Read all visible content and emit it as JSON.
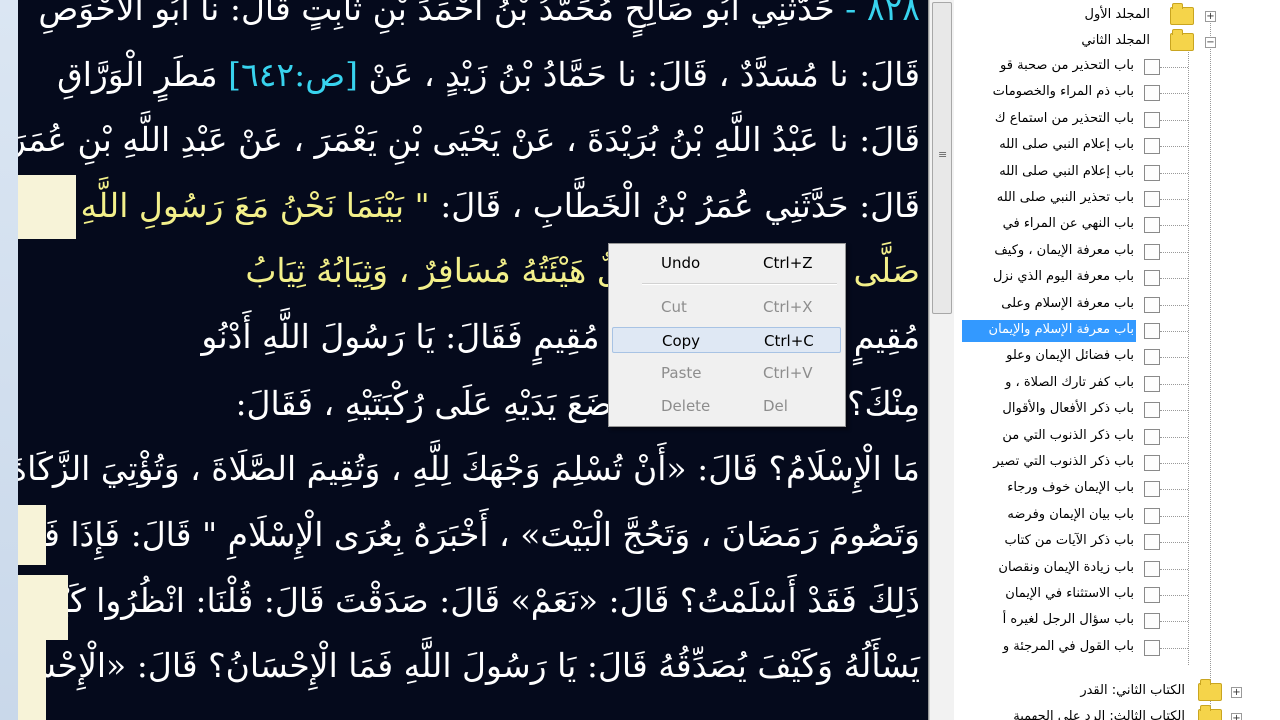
{
  "reader": {
    "lines": [
      {
        "text": "حَدَّثَنِي أَبُو صَالِحٍ مُحَمَّدُ بْنُ أَحْمَدَ بْنِ ثَابِتٍ قَالَ: نا أَبُو الْأَحْوَصِ",
        "number": "٨٢٨ -",
        "color": "white"
      },
      {
        "text": "قَالَ: نا مُسَدَّدٌ ، قَالَ: نا حَمَّادُ بْنُ زَيْدٍ ، عَنْ",
        "page_ref": "[ص:٦٤٢]",
        "text2": "مَطَرٍ الْوَرَّاقِ",
        "color": "white"
      },
      {
        "text": "قَالَ: نا عَبْدُ اللَّهِ بْنُ بُرَيْدَةَ ، عَنْ يَحْيَى بْنِ يَعْمَرَ ، عَنْ عَبْدِ اللَّهِ بْنِ عُمَرَ",
        "color": "white"
      },
      {
        "text": "قَالَ: حَدَّثَنِي عُمَرُ بْنُ الْخَطَّابِ ، قَالَ:",
        "hadith": "\" بَيْنَمَا نَحْنُ مَعَ رَسُولِ اللَّهِ",
        "color": "white"
      },
      {
        "text": "صَلَّى ا",
        "hadith": "يَوْمٍ إِذْ جَاءَهُ رَجُلٌ هَيْئَتُهُ مُسَافِرٌ ، وَثِيَابُهُ ثِيَابُ",
        "color": "yellow"
      },
      {
        "text": "مُقِيمٍ ،",
        "text2": "فِرٍ ، وَهَيْئَتُهُ هَيْئَةُ مُقِيمٍ فَقَالَ: يَا رَسُولَ اللَّهِ أَدْنُو",
        "color": "white"
      },
      {
        "text": "مِنْكَ؟",
        "text2": "فَدَنَا مِنْهُ ، حَتَّى وَضَعَ يَدَيْهِ عَلَى رُكْبَتَيْهِ ، فَقَالَ:",
        "color": "white"
      },
      {
        "text": "مَا الْإِسْلَامُ؟ قَالَ: «أَنْ تُسْلِمَ وَجْهَكَ لِلَّهِ ، وَتُقِيمَ الصَّلَاةَ ، وَتُؤْتِيَ الزَّكَاةَ ،",
        "color": "white"
      },
      {
        "text": "وَتَصُومَ رَمَضَانَ ، وَتَحُجَّ الْبَيْتَ» ، أَخْبَرَهُ بِعُرَى الْإِسْلَامِ \" قَالَ: فَإِذَا فَعَلْتُ",
        "color": "white"
      },
      {
        "text": "ذَلِكَ فَقَدْ أَسْلَمْتُ؟ قَالَ: «نَعَمْ» قَالَ: صَدَقْتَ قَالَ: قُلْنَا: انْظُرُوا كَيْفَ",
        "color": "white"
      },
      {
        "text": "يَسْأَلُهُ وَكَيْفَ يُصَدِّقُهُ قَالَ: يَا رَسُولَ اللَّهِ فَمَا الْإِحْسَانُ؟ قَالَ: «الْإِحْسَانُ",
        "color": "white"
      }
    ]
  },
  "context_menu": {
    "items": [
      {
        "label": "Undo",
        "shortcut": "Ctrl+Z",
        "enabled": true
      },
      {
        "label": "Cut",
        "shortcut": "Ctrl+X",
        "enabled": false
      },
      {
        "label": "Copy",
        "shortcut": "Ctrl+C",
        "enabled": true,
        "hover": true
      },
      {
        "label": "Paste",
        "shortcut": "Ctrl+V",
        "enabled": false
      },
      {
        "label": "Delete",
        "shortcut": "Del",
        "enabled": false
      }
    ]
  },
  "tree": {
    "volumes": [
      {
        "label": "المجلد الأول",
        "expander": "+"
      },
      {
        "label": "المجلد الثاني",
        "expander": "−"
      }
    ],
    "chapters": [
      "باب التحذير من صحبة قو",
      "باب ذم المراء والخصومات",
      "باب التحذير من استماع ك",
      "باب إعلام النبي صلى الله",
      "باب إعلام النبي صلى الله",
      "باب تحذير النبي صلى الله",
      "باب النهي عن المراء في",
      "باب معرفة الإيمان ، وكيف",
      "باب معرفة اليوم الذي نزل",
      "باب معرفة الإسلام وعلى",
      "باب معرفة الإسلام والإيمان",
      "باب فضائل الإيمان وعلو",
      "باب كفر تارك الصلاة ، و",
      "باب ذكر الأفعال والأقوال",
      "باب ذكر الذنوب التي من",
      "باب ذكر الذنوب التي تصير",
      "باب الإيمان خوف ورجاء",
      "باب بيان الإيمان وفرضه",
      "باب ذكر الآيات من كتاب",
      "باب زيادة الإيمان ونقصان",
      "باب الاستثناء في الإيمان",
      "باب سؤال الرجل لغيره أ",
      "باب القول في المرجئة و"
    ],
    "selected_index": 10,
    "books": [
      {
        "label": "الكتاب الثاني: القدر",
        "expander": "+"
      },
      {
        "label": "الكتاب الثالث: الرد على الجهمية",
        "expander": "+"
      }
    ]
  }
}
